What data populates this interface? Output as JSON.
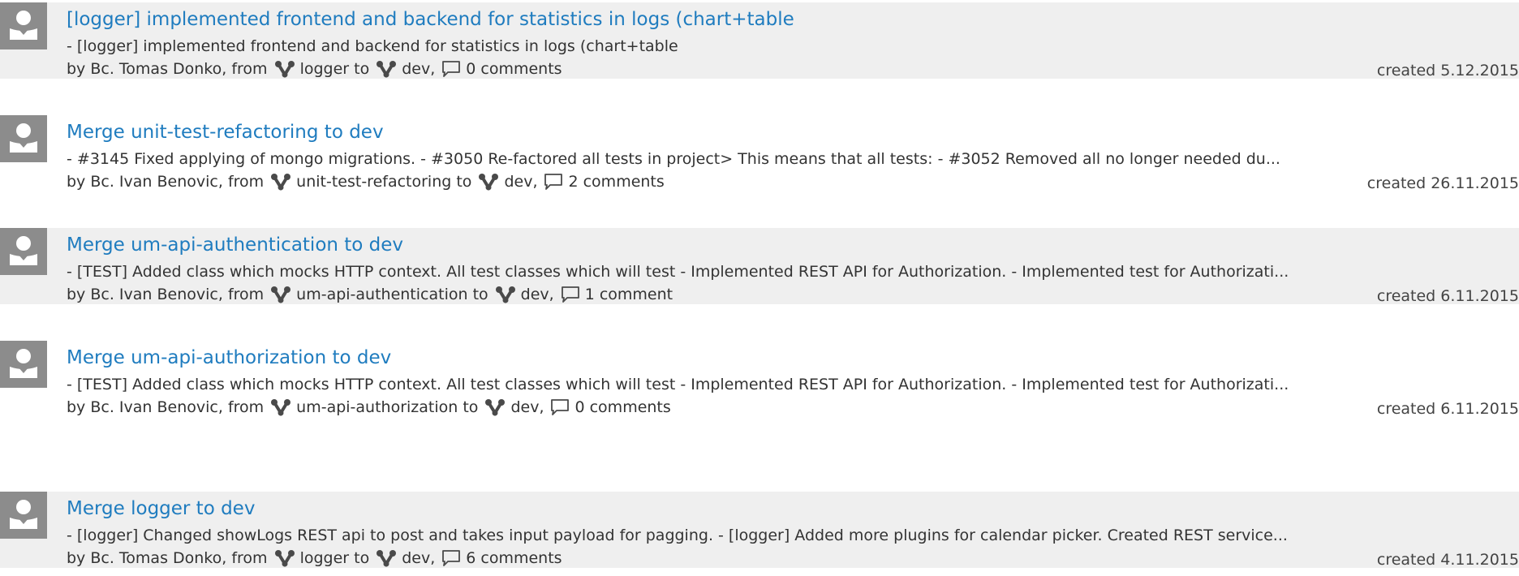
{
  "pull_requests": [
    {
      "title": "[logger] implemented frontend and backend for statistics in logs (chart+table",
      "description": "- [logger] implemented frontend and backend for statistics in logs (chart+table",
      "by_prefix": "by",
      "author": "Bc. Tomas Donko",
      "from_word": ", from",
      "source_branch": "logger",
      "to_word": "to",
      "target_branch": "dev",
      "comments": "0 comments",
      "created": "created 5.12.2015",
      "avatar_icon": "user-avatar-icon",
      "branch_icon": "branch-merge-icon",
      "comment_icon": "comment-bubble-icon"
    },
    {
      "title": "Merge unit-test-refactoring to dev",
      "description": "- #3145 Fixed applying of mongo migrations. - #3050 Re-factored all tests in project> This means that all tests: - #3052 Removed all no longer needed du...",
      "by_prefix": "by",
      "author": "Bc. Ivan Benovic",
      "from_word": ", from",
      "source_branch": "unit-test-refactoring",
      "to_word": "to",
      "target_branch": "dev",
      "comments": "2 comments",
      "created": "created 26.11.2015",
      "avatar_icon": "user-avatar-icon",
      "branch_icon": "branch-merge-icon",
      "comment_icon": "comment-bubble-icon"
    },
    {
      "title": "Merge um-api-authentication to dev",
      "description": "- [TEST] Added class which mocks HTTP context. All test classes which will test  - Implemented REST API for Authorization. - Implemented test for Authorizati...",
      "by_prefix": "by",
      "author": "Bc. Ivan Benovic",
      "from_word": ", from",
      "source_branch": "um-api-authentication",
      "to_word": "to",
      "target_branch": "dev",
      "comments": "1 comment",
      "created": "created 6.11.2015",
      "avatar_icon": "user-avatar-icon",
      "branch_icon": "branch-merge-icon",
      "comment_icon": "comment-bubble-icon"
    },
    {
      "title": "Merge um-api-authorization to dev",
      "description": "- [TEST] Added class which mocks HTTP context. All test classes which will test  - Implemented REST API for Authorization. - Implemented test for Authorizati...",
      "by_prefix": "by",
      "author": "Bc. Ivan Benovic",
      "from_word": ", from",
      "source_branch": "um-api-authorization",
      "to_word": "to",
      "target_branch": "dev",
      "comments": "0 comments",
      "created": "created 6.11.2015",
      "avatar_icon": "user-avatar-icon",
      "branch_icon": "branch-merge-icon",
      "comment_icon": "comment-bubble-icon"
    },
    {
      "title": "Merge logger to dev",
      "description": "- [logger] Changed showLogs REST api to post and takes input payload for pagging. - [logger] Added more plugins for calendar picker. Created REST service...",
      "by_prefix": "by",
      "author": "Bc. Tomas Donko",
      "from_word": ", from",
      "source_branch": "logger",
      "to_word": "to",
      "target_branch": "dev",
      "comments": "6 comments",
      "created": "created 4.11.2015",
      "avatar_icon": "user-avatar-icon",
      "branch_icon": "branch-merge-icon",
      "comment_icon": "comment-bubble-icon"
    }
  ],
  "colors": {
    "link": "#1f7cbf",
    "row_shaded": "#efefef",
    "avatar_bg": "#8c8c8c",
    "text": "#333333"
  }
}
